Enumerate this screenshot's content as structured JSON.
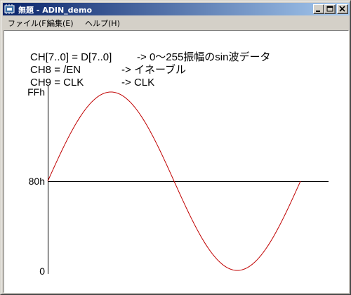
{
  "window": {
    "title": "無題 - ADIN_demo",
    "icon": "app-chip-icon",
    "controls": [
      "minimize-icon",
      "maximize-icon",
      "close-icon"
    ]
  },
  "menu": {
    "file": "ファイル(F)",
    "edit": "編集(E)",
    "help": "ヘルプ(H)"
  },
  "description": {
    "line1_left": "CH[7..0] = D[7..0]",
    "line1_right": "-> 0～255振幅のsin波データ",
    "line2_left": "CH8 = /EN",
    "line2_right": "-> イネーブル",
    "line3_left": "CH9 = CLK",
    "line3_right": "-> CLK"
  },
  "chart_data": {
    "type": "line",
    "title": "",
    "xlabel": "",
    "ylabel": "",
    "ytick_labels": [
      "FFh",
      "80h",
      "0"
    ],
    "yticks": [
      255,
      128,
      0
    ],
    "ylim": [
      0,
      255
    ],
    "xlim": [
      0,
      1
    ],
    "series": [
      {
        "color": "#c00000",
        "function": "128 + 127*sin(2*pi*x)",
        "x": [
          0,
          0.125,
          0.25,
          0.375,
          0.5,
          0.625,
          0.75,
          0.875,
          1.0
        ],
        "values": [
          128,
          218,
          255,
          218,
          128,
          38,
          0,
          38,
          128
        ]
      }
    ],
    "baseline": 128,
    "grid": false,
    "colors": {
      "sine": "#c00000",
      "axis": "#000000"
    }
  }
}
